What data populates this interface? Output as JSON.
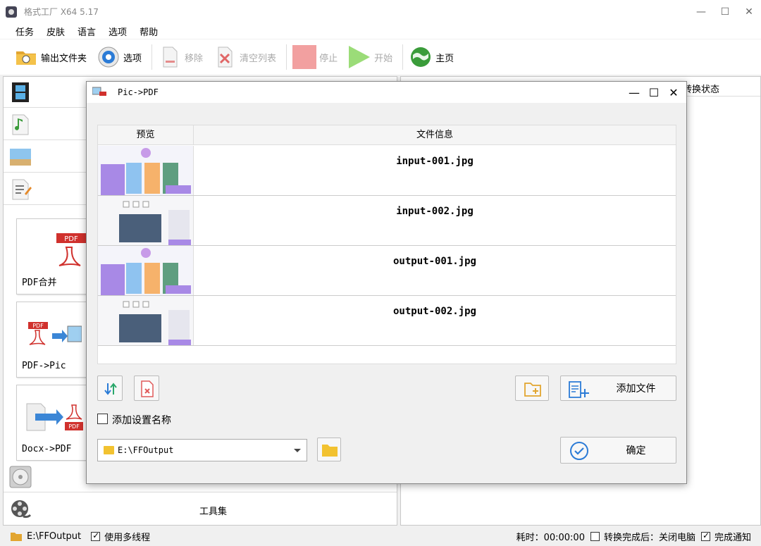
{
  "window": {
    "title": "格式工厂 X64 5.17",
    "minimize": "—",
    "maximize": "☐",
    "close": "✕"
  },
  "menu": [
    "任务",
    "皮肤",
    "语言",
    "选项",
    "帮助"
  ],
  "toolbar": {
    "output_folder": "输出文件夹",
    "options": "选项",
    "remove": "移除",
    "clear_list": "清空列表",
    "stop": "停止",
    "start": "开始",
    "home": "主页"
  },
  "right_pane": {
    "status_header": "转换状态"
  },
  "left_pane": {
    "tiles": [
      "PDF合并",
      "PDF->Pic",
      "Docx->PDF"
    ],
    "toolset": "工具集"
  },
  "dialog": {
    "title": "Pic->PDF",
    "header_preview": "预览",
    "header_info": "文件信息",
    "files": [
      "input-001.jpg",
      "input-002.jpg",
      "output-001.jpg",
      "output-002.jpg"
    ],
    "add_file": "添加文件",
    "add_settings_name": "添加设置名称",
    "output_path": "E:\\FFOutput",
    "confirm": "确定"
  },
  "status": {
    "output_path": "E:\\FFOutput",
    "multithread": "使用多线程",
    "elapsed": "耗时：00:00:00",
    "after_convert": "转换完成后：关闭电脑",
    "notify": "完成通知"
  },
  "colors": {
    "accent_blue": "#2b7bd6",
    "start_green": "#8fd46a",
    "stop_red": "#f08a8a",
    "folder_yellow": "#f2c230"
  }
}
